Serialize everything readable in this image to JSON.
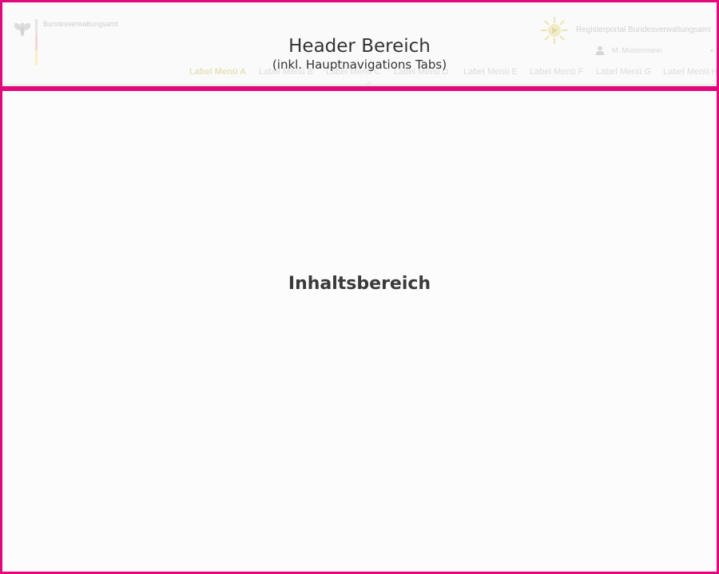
{
  "header": {
    "agency_name": "Bundesverwaltungsamt",
    "portal_name": "Registerportal  Bundesverwaltungsamt",
    "user_name": "M. Mustermann",
    "overlay_title": "Header Bereich",
    "overlay_subtitle": "(inkl. Hauptnavigations Tabs)",
    "tabs": [
      {
        "label": "Label Menü A",
        "active": true
      },
      {
        "label": "Label Menü B",
        "active": false
      },
      {
        "label": "Label Menü C",
        "active": false
      },
      {
        "label": "Label Menü D",
        "active": false
      },
      {
        "label": "Label Menü E",
        "active": false
      },
      {
        "label": "Label Menü F",
        "active": false
      },
      {
        "label": "Label Menü G",
        "active": false
      },
      {
        "label": "Label Menü H",
        "active": false
      }
    ]
  },
  "content": {
    "overlay_label": "Inhaltsbereich"
  },
  "icons": {
    "agency_logo": "federal-eagle-icon",
    "portal_logo": "portal-sun-icon",
    "user": "user-icon",
    "user_menu": "chevron-down-icon"
  },
  "colors": {
    "region_border": "#e0087c",
    "active_tab": "#e6e3b8"
  }
}
